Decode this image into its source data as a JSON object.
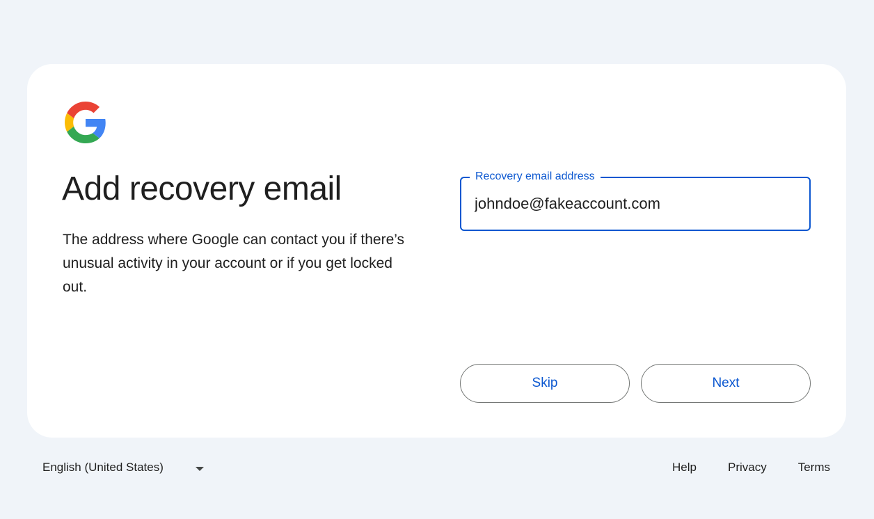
{
  "page": {
    "title": "Add recovery email",
    "description": "The address where Google can contact you if there’s unusual activity in your account or if you get locked out."
  },
  "recovery_field": {
    "label": "Recovery email address",
    "value": "johndoe@fakeaccount.com"
  },
  "buttons": {
    "skip_label": "Skip",
    "next_label": "Next"
  },
  "footer": {
    "language": "English (United States)",
    "links": [
      "Help",
      "Privacy",
      "Terms"
    ]
  },
  "icons": {
    "logo": "google-logo-icon",
    "language_caret": "caret-down-icon"
  },
  "colors": {
    "accent": "#0b57d0",
    "background": "#f0f4f9",
    "card": "#ffffff",
    "google_blue": "#4285F4",
    "google_red": "#EA4335",
    "google_yellow": "#FBBC05",
    "google_green": "#34A853"
  }
}
